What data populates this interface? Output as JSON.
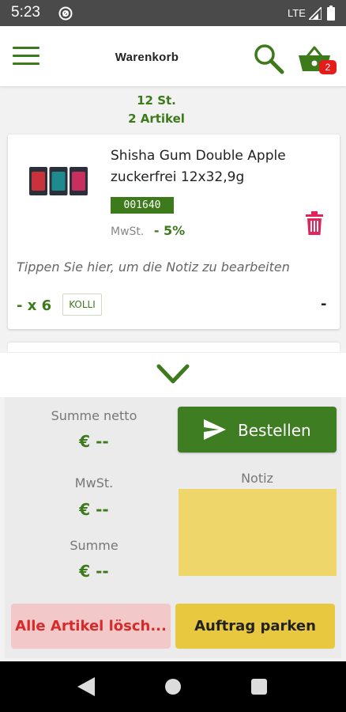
{
  "status_bar": {
    "time": "5:23",
    "network": "LTE"
  },
  "header": {
    "title": "Warenkorb",
    "cart_badge": "2"
  },
  "cart_summary": {
    "pieces": "12 St.",
    "articles": "2 Artikel"
  },
  "items": [
    {
      "name": "Shisha Gum Double Apple zuckerfrei 12x32,9g",
      "sku": "001640",
      "tax_label": "MwSt.",
      "tax_value": "- 5%",
      "note_hint": "Tippen Sie hier, um die Notiz zu bearbeiten",
      "quantity": "- x 6",
      "unit": "KOLLI",
      "price": "-"
    }
  ],
  "totals": {
    "net_label": "Summe netto",
    "net_value": "€ --",
    "tax_label": "MwSt.",
    "tax_value": "€ --",
    "sum_label": "Summe",
    "sum_value": "€ --"
  },
  "actions": {
    "order_label": "Bestellen",
    "note_label": "Notiz",
    "delete_all_label": "Alle Artikel lösch...",
    "park_label": "Auftrag parken"
  },
  "colors": {
    "brand_green": "#3c7a1c",
    "note_yellow": "#efd66a",
    "park_yellow": "#e8c83e",
    "delete_red": "#d72a2a",
    "badge_red": "#e41c1c"
  }
}
